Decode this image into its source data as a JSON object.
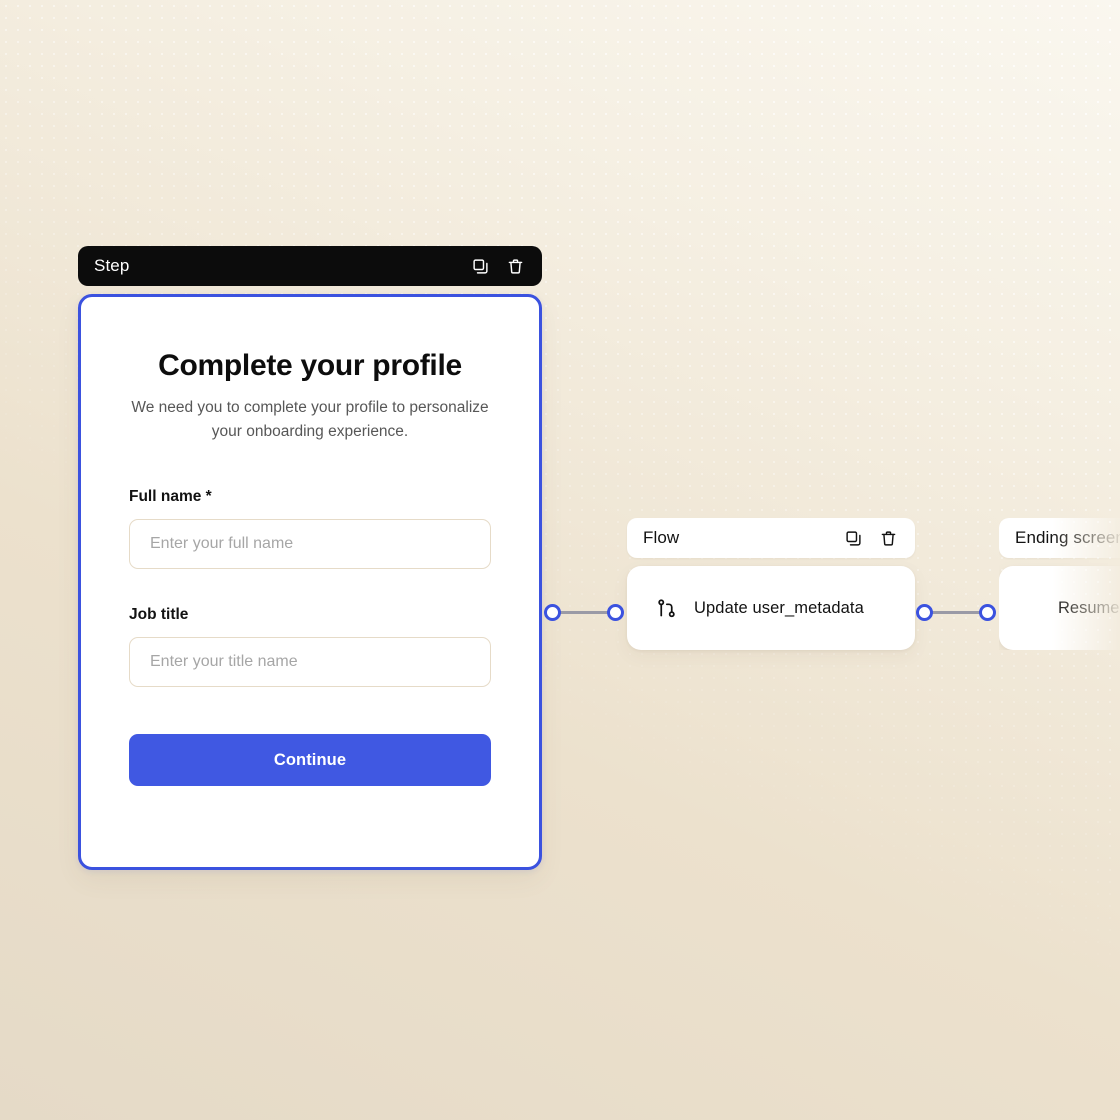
{
  "canvas": {
    "background_top_color": "#faf7ef",
    "background_bottom_color": "#e5dac7",
    "accent_color": "#3b52df",
    "button_color": "#4058e2"
  },
  "step_node": {
    "header": {
      "title": "Step",
      "duplicate_icon": "copy-icon",
      "delete_icon": "trash-icon"
    },
    "form": {
      "title": "Complete your profile",
      "subtitle": "We need you to complete your profile to personalize your onboarding experience.",
      "fields": [
        {
          "label": "Full name *",
          "placeholder": "Enter your full name",
          "value": ""
        },
        {
          "label": "Job title",
          "placeholder": "Enter your title name",
          "value": ""
        }
      ],
      "submit_label": "Continue"
    }
  },
  "flow_node": {
    "header": {
      "title": "Flow",
      "duplicate_icon": "copy-icon",
      "delete_icon": "trash-icon"
    },
    "row": {
      "icon": "git-branch-icon",
      "label": "Update user_metadata"
    }
  },
  "ending_node": {
    "header": {
      "title": "Ending screen"
    },
    "row": {
      "label": "Resume auth"
    }
  }
}
